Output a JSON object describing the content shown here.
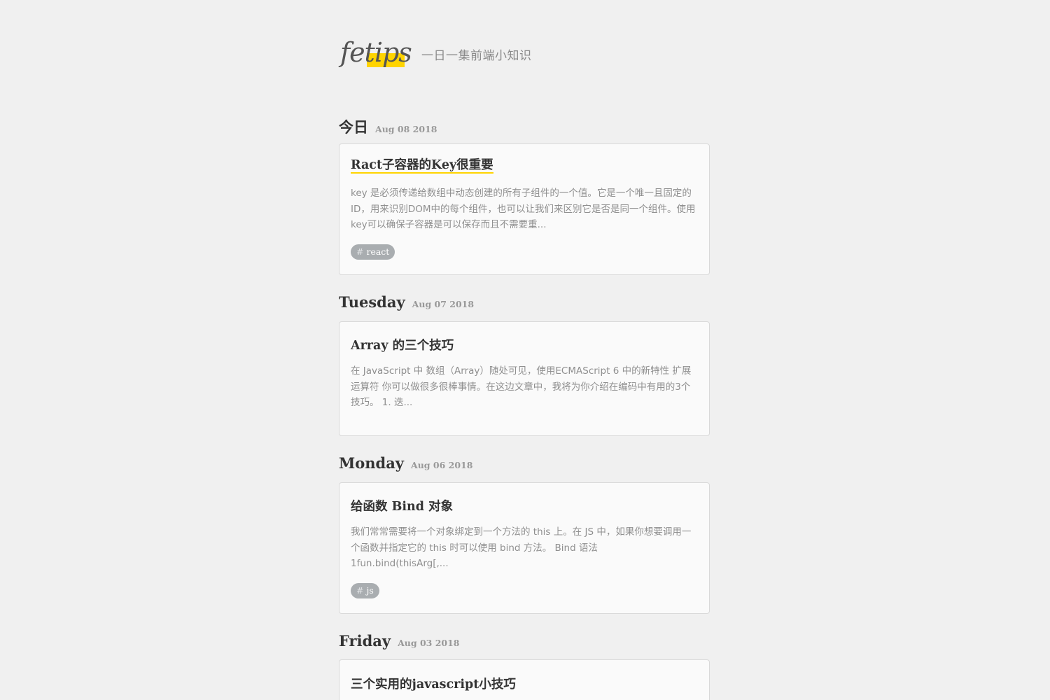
{
  "site": {
    "logo": "fetips",
    "tagline": "一日一集前端小知识"
  },
  "colors": {
    "accent": "#ffd400",
    "background": "#f0f0f0",
    "card_bg": "#fafafa",
    "tag_bg": "#a9adb0"
  },
  "days": [
    {
      "name": "今日",
      "date": "Aug 08 2018",
      "post": {
        "title": "Ract子容器的Key很重要",
        "excerpt": "key 是必须传递给数组中动态创建的所有子组件的一个值。它是一个唯一且固定的ID，用来识别DOM中的每个组件，也可以让我们来区别它是否是同一个组件。使用key可以确保子容器是可以保存而且不需要重...",
        "tag": "react",
        "tag_hash": "#"
      }
    },
    {
      "name": "Tuesday",
      "date": "Aug 07 2018",
      "post": {
        "title": "Array 的三个技巧",
        "excerpt": "在 JavaScript 中 数组（Array）随处可见，使用ECMAScript 6 中的新特性 扩展运算符 你可以做很多很棒事情。在这边文章中，我将为你介绍在编码中有用的3个技巧。 1. 迭...",
        "tag": ""
      }
    },
    {
      "name": "Monday",
      "date": "Aug 06 2018",
      "post": {
        "title": "给函数 Bind 对象",
        "excerpt": "我们常常需要将一个对象绑定到一个方法的 this 上。在 JS 中，如果你想要调用一个函数并指定它的 this 时可以使用 bind 方法。 Bind 语法 1fun.bind(thisArg[,...",
        "tag": "js",
        "tag_hash": "#"
      }
    },
    {
      "name": "Friday",
      "date": "Aug 03 2018",
      "post": {
        "title": "三个实用的javascript小技巧",
        "excerpt": "",
        "tag": ""
      }
    }
  ]
}
